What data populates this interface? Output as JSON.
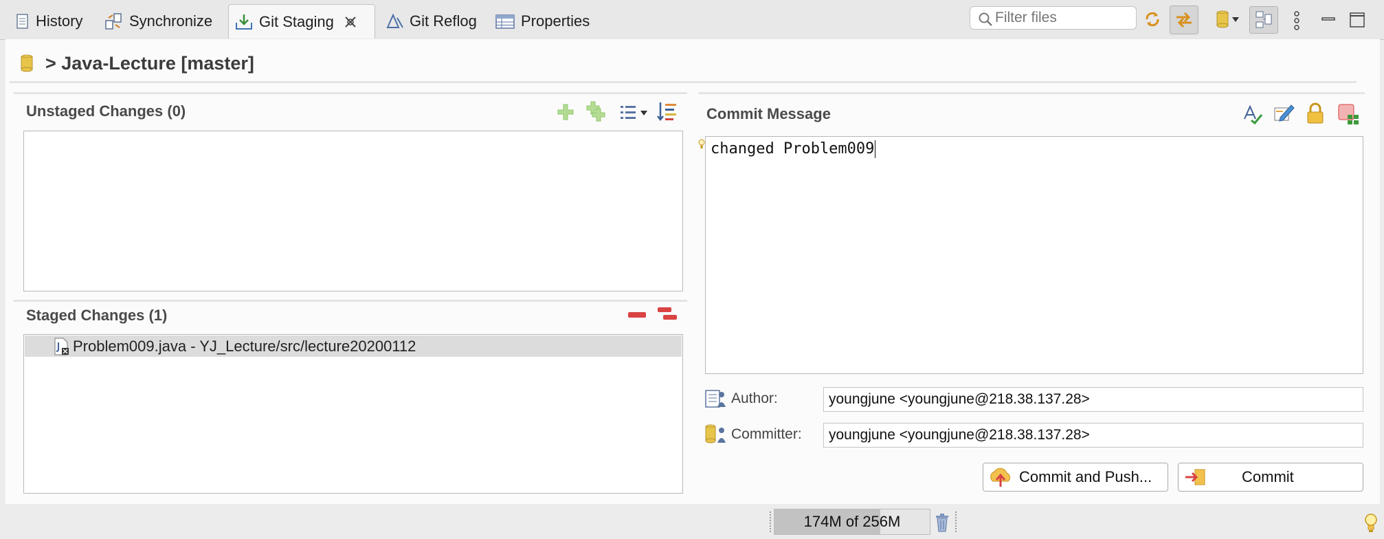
{
  "tabs": [
    {
      "label": "History",
      "icon": "history-icon"
    },
    {
      "label": "Synchronize",
      "icon": "synchronize-icon"
    },
    {
      "label": "Git Staging",
      "icon": "git-staging-icon",
      "active": true
    },
    {
      "label": "Git Reflog",
      "icon": "git-reflog-icon"
    },
    {
      "label": "Properties",
      "icon": "properties-icon"
    }
  ],
  "filter": {
    "placeholder": "Filter files"
  },
  "repo": {
    "title": "> Java-Lecture [master]"
  },
  "unstaged": {
    "title": "Unstaged Changes (0)",
    "items": []
  },
  "staged": {
    "title": "Staged Changes (1)",
    "items": [
      {
        "label": "Problem009.java - YJ_Lecture/src/lecture20200112"
      }
    ]
  },
  "commit": {
    "title": "Commit Message",
    "message": "changed Problem009",
    "author_label": "Author:",
    "author_value": "youngjune <youngjune@218.38.137.28>",
    "committer_label": "Committer:",
    "committer_value": "youngjune <youngjune@218.38.137.28>",
    "commit_push_label": "Commit and Push...",
    "commit_label": "Commit"
  },
  "status": {
    "heap": "174M of 256M",
    "heap_used_fraction": 0.68
  },
  "colors": {
    "accent_green": "#8fc76b",
    "remove_red": "#d94343",
    "repo_yellow": "#e7c54a"
  }
}
